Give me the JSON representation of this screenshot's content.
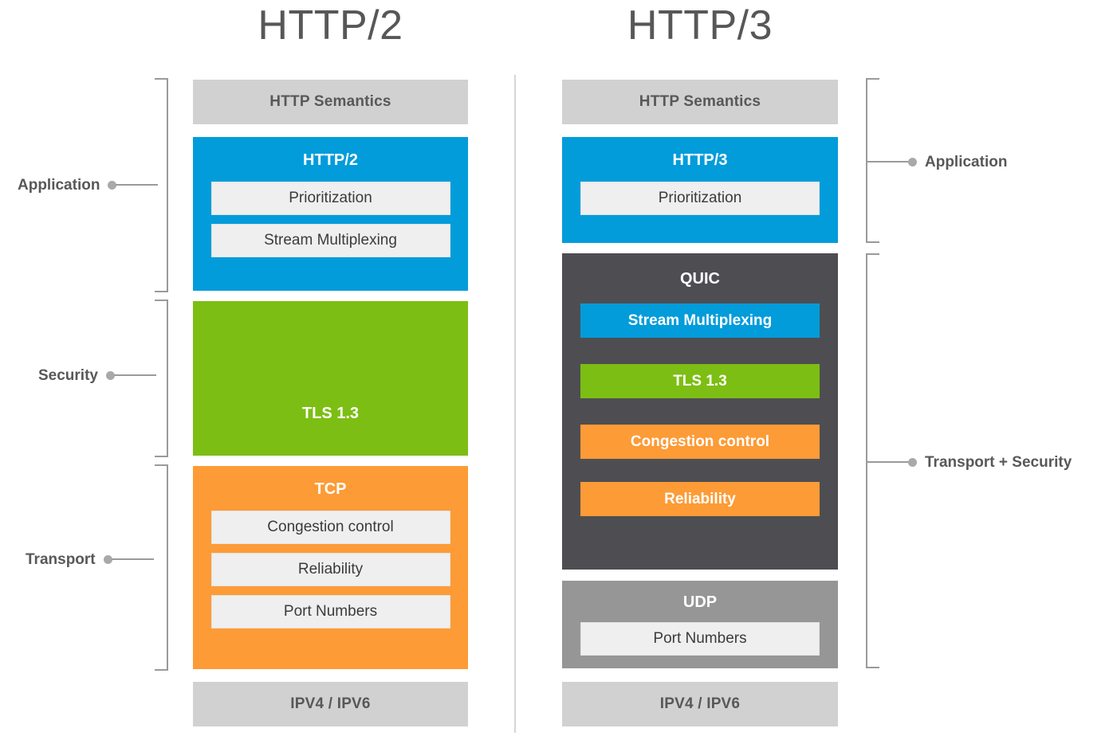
{
  "titles": {
    "left": "HTTP/2",
    "right": "HTTP/3"
  },
  "colors": {
    "blue": "#029CDB",
    "green": "#7CBE13",
    "orange": "#FD9B36",
    "dark_gray": "#4E4E52",
    "mid_gray": "#969696",
    "light_gray": "#D1D1D1",
    "subbox": "#EFEFEF",
    "text_gray": "#58585A",
    "line_gray": "#9A9A9A"
  },
  "left_stack": {
    "semantics": {
      "label": "HTTP Semantics"
    },
    "http2": {
      "label": "HTTP/2",
      "items": [
        "Prioritization",
        "Stream Multiplexing"
      ]
    },
    "tls": {
      "label": "TLS 1.3"
    },
    "tcp": {
      "label": "TCP",
      "items": [
        "Congestion control",
        "Reliability",
        "Port Numbers"
      ]
    },
    "ip": {
      "label": "IPV4 / IPV6"
    }
  },
  "right_stack": {
    "semantics": {
      "label": "HTTP Semantics"
    },
    "http3": {
      "label": "HTTP/3",
      "items": [
        "Prioritization"
      ]
    },
    "quic": {
      "label": "QUIC",
      "items": [
        {
          "label": "Stream Multiplexing",
          "color": "blue"
        },
        {
          "label": "TLS 1.3",
          "color": "green"
        },
        {
          "label": "Congestion control",
          "color": "orange"
        },
        {
          "label": "Reliability",
          "color": "orange"
        }
      ]
    },
    "udp": {
      "label": "UDP",
      "items": [
        "Port Numbers"
      ]
    },
    "ip": {
      "label": "IPV4 / IPV6"
    }
  },
  "left_callouts": [
    {
      "label": "Application"
    },
    {
      "label": "Security"
    },
    {
      "label": "Transport"
    }
  ],
  "right_callouts": [
    {
      "label": "Application"
    },
    {
      "label": "Transport + Security"
    }
  ]
}
